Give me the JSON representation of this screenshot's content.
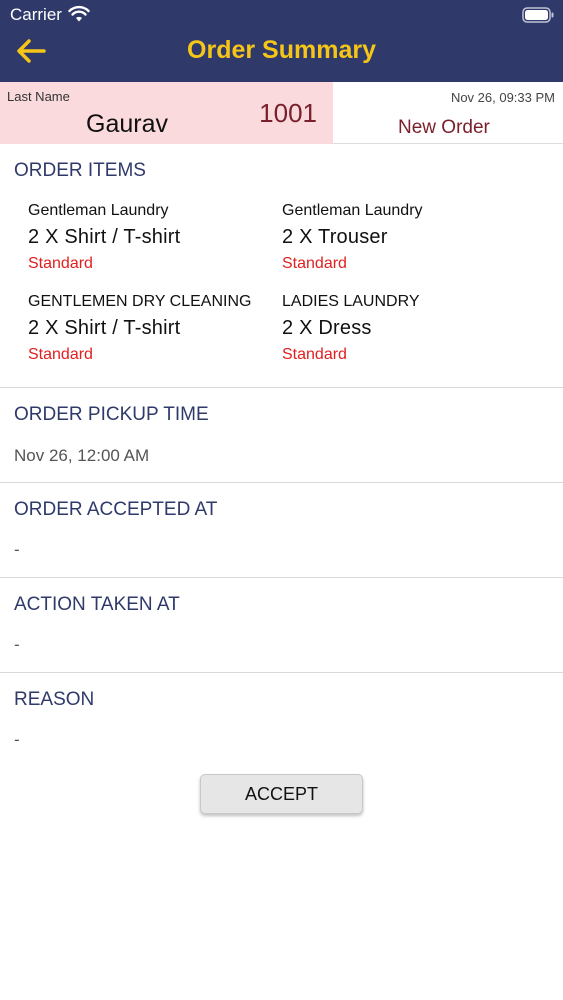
{
  "status_bar": {
    "carrier": "Carrier"
  },
  "nav": {
    "title": "Order Summary"
  },
  "header": {
    "last_name_label": "Last Name",
    "last_name": "Gaurav",
    "order_number": "1001",
    "datetime": "Nov 26, 09:33 PM",
    "status": "New Order"
  },
  "order_items": {
    "title": "ORDER ITEMS",
    "items": [
      {
        "category": "Gentleman Laundry",
        "quantity_line": "2  X  Shirt / T-shirt",
        "service": "Standard"
      },
      {
        "category": "Gentleman Laundry",
        "quantity_line": "2  X  Trouser",
        "service": "Standard"
      },
      {
        "category": "GENTLEMEN DRY CLEANING",
        "quantity_line": "2  X  Shirt / T-shirt",
        "service": "Standard"
      },
      {
        "category": "LADIES LAUNDRY",
        "quantity_line": "2  X  Dress",
        "service": "Standard"
      }
    ]
  },
  "pickup": {
    "title": "ORDER PICKUP TIME",
    "value": "Nov 26, 12:00 AM"
  },
  "accepted": {
    "title": "ORDER ACCEPTED AT",
    "value": "-"
  },
  "action": {
    "title": "ACTION TAKEN AT",
    "value": "-"
  },
  "reason": {
    "title": "REASON",
    "value": "-"
  },
  "buttons": {
    "accept": "ACCEPT"
  },
  "colors": {
    "nav_bg": "#2f3a6b",
    "title_yellow": "#f5c518",
    "header_pink": "#fadadd",
    "maroon": "#7a1f2b",
    "service_red": "#e02020"
  },
  "icons": {
    "back": "arrow-left-icon",
    "wifi": "wifi-icon",
    "battery": "battery-icon"
  }
}
